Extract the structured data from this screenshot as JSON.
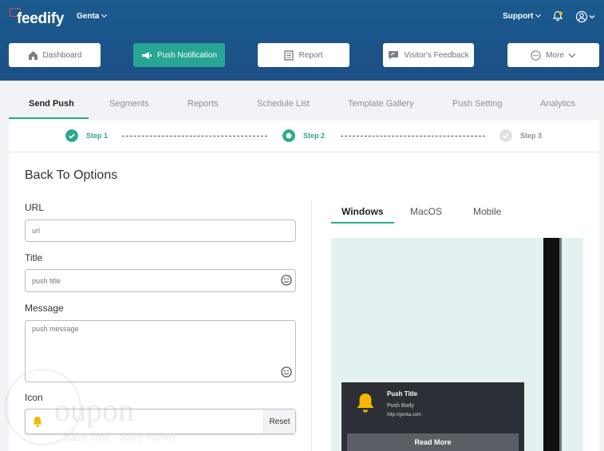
{
  "header": {
    "logo": "feedify",
    "account": "Genta",
    "support": "Support",
    "nav": [
      "Dashboard",
      "Push Notification",
      "Report",
      "Visitor's Feedback",
      "More"
    ]
  },
  "tabs": [
    "Send Push",
    "Segments",
    "Reports",
    "Schedule List",
    "Template Gallery",
    "Push Setting",
    "Analytics"
  ],
  "steps": [
    "Step 1",
    "Step 2",
    "Step 3"
  ],
  "form": {
    "back": "Back To Options",
    "url_label": "URL",
    "url_placeholder": "url",
    "title_label": "Title",
    "title_placeholder": "push title",
    "message_label": "Message",
    "message_placeholder": "push message",
    "icon_label": "Icon",
    "reset": "Reset"
  },
  "preview": {
    "tabs": [
      "Windows",
      "MacOS",
      "Mobile"
    ],
    "title": "Push Title",
    "body": "Push Body",
    "url": "http://genta.com",
    "button": "Read More"
  },
  "watermark": {
    "text": "oupon",
    "sub": "Save time · Save money"
  },
  "colors": {
    "header": "#1c4f85",
    "accent": "#27a595",
    "bell": "#f5b700"
  }
}
